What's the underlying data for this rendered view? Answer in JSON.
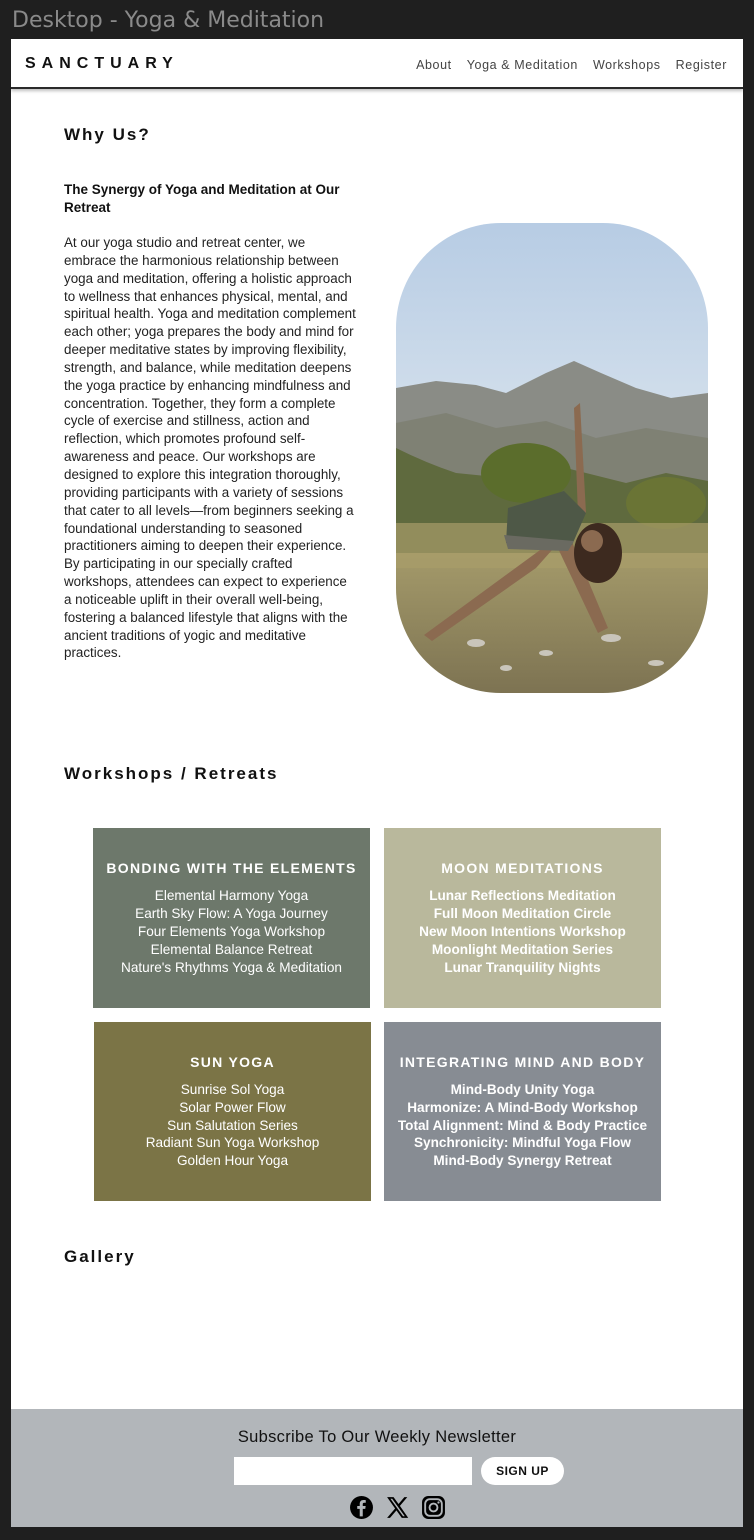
{
  "frame": {
    "label": "Desktop - Yoga & Meditation"
  },
  "header": {
    "logo": "SANCTUARY",
    "nav": [
      "About",
      "Yoga & Meditation",
      "Workshops",
      "Register"
    ]
  },
  "why": {
    "title": "Why Us?",
    "heading": "The Synergy of Yoga and Meditation at Our Retreat",
    "body": "At our yoga studio and retreat center, we embrace the harmonious relationship between yoga and meditation, offering a holistic approach to wellness that enhances physical, mental, and spiritual health. Yoga and meditation complement each other; yoga prepares the body and mind for deeper meditative states by improving flexibility, strength, and balance, while meditation deepens the yoga practice by enhancing mindfulness and concentration. Together, they form a complete cycle of exercise and stillness, action and reflection, which promotes profound self-awareness and peace. Our workshops are designed to explore this integration thoroughly, providing participants with a variety of sessions that cater to all levels—from beginners seeking a foundational understanding to seasoned practitioners aiming to deepen their experience. By participating in our specially crafted workshops, attendees can expect to experience a noticeable uplift in their overall well-being, fostering a balanced lifestyle that aligns with the ancient traditions of yogic and meditative practices."
  },
  "workshops": {
    "title": "Workshops / Retreats",
    "cards": [
      {
        "title": "BONDING WITH THE ELEMENTS",
        "color": "#6d786b",
        "items": [
          "Elemental Harmony Yoga",
          "Earth Sky Flow: A Yoga Journey",
          "Four Elements Yoga Workshop",
          "Elemental Balance Retreat",
          "Nature's Rhythms Yoga & Meditation"
        ]
      },
      {
        "title": "MOON MEDITATIONS",
        "color": "#b9b89c",
        "items": [
          "Lunar Reflections Meditation",
          "Full Moon Meditation Circle",
          "New Moon Intentions Workshop",
          "Moonlight Meditation Series",
          "Lunar Tranquility Nights"
        ]
      },
      {
        "title": "SUN YOGA",
        "color": "#7b7446",
        "items": [
          "Sunrise Sol Yoga",
          "Solar Power Flow",
          "Sun Salutation Series",
          "Radiant Sun Yoga Workshop",
          "Golden Hour Yoga"
        ]
      },
      {
        "title": "INTEGRATING MIND AND BODY",
        "color": "#878c93",
        "items": [
          "Mind-Body Unity Yoga",
          "Harmonize: A Mind-Body Workshop",
          "Total Alignment: Mind & Body Practice",
          "Synchronicity: Mindful Yoga Flow",
          "Mind-Body Synergy Retreat"
        ]
      }
    ]
  },
  "gallery": {
    "title": "Gallery"
  },
  "newsletter": {
    "title": "Subscribe To Our Weekly Newsletter",
    "input_placeholder": "",
    "button": "SIGN UP",
    "socials": [
      "facebook-icon",
      "x-icon",
      "instagram-icon"
    ]
  }
}
